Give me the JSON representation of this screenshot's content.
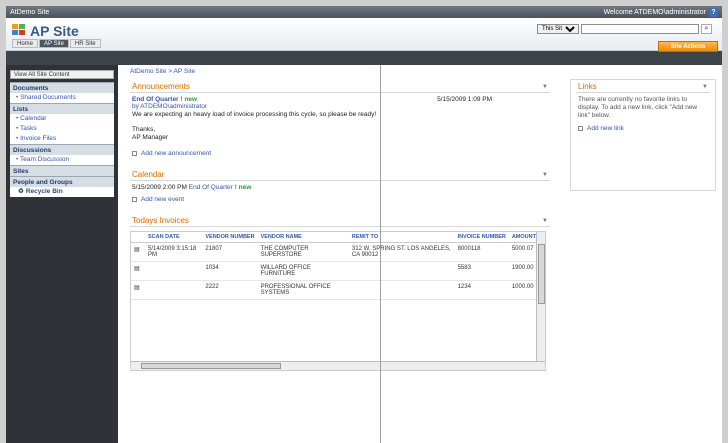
{
  "topbar": {
    "site": "AtDemo Site",
    "welcome": "Welcome ATDEMO\\administrator",
    "help": "?"
  },
  "header": {
    "title": "AP Site",
    "search_scope": "This Site",
    "search_go": "⌕"
  },
  "nav_tabs": [
    "Home",
    "AP Site",
    "HR Site"
  ],
  "site_actions": "Site Actions",
  "breadcrumb": "AtDemo Site > AP Site",
  "leftnav": {
    "view_all": "View All Site Content",
    "sections": [
      {
        "title": "Documents",
        "items": [
          "Shared Documents"
        ]
      },
      {
        "title": "Lists",
        "items": [
          "Calendar",
          "Tasks",
          "Invoice Files"
        ]
      },
      {
        "title": "Discussions",
        "items": [
          "Team Discussion"
        ]
      },
      {
        "title": "Sites",
        "items": []
      },
      {
        "title": "People and Groups",
        "items": []
      }
    ],
    "recycle_bin": "Recycle Bin"
  },
  "announcements": {
    "title": "Announcements",
    "item_title": "End Of Quarter",
    "item_new": "! new",
    "item_date": "5/15/2009 1:09 PM",
    "item_by": "by ATDEMO\\administrator",
    "item_body": "We are expecting an heavy load of invoice processing this cycle, so please be ready!",
    "item_sign1": "Thanks,",
    "item_sign2": "AP Manager",
    "add_new": "Add new announcement"
  },
  "calendar": {
    "title": "Calendar",
    "entry_date": "5/15/2009 2:00 PM",
    "entry_title": "End Of Quarter",
    "entry_new": "! new",
    "add_new": "Add new event"
  },
  "invoices": {
    "title": "Todays Invoices",
    "columns": [
      "SCAN DATE",
      "VENDOR NUMBER",
      "VENDOR NAME",
      "REMIT TO",
      "INVOICE NUMBER",
      "AMOUNT"
    ],
    "rows": [
      {
        "scan": "5/14/2009 3:15:18 PM",
        "vnum": "21807",
        "vname": "THE COMPUTER SUPERSTORE",
        "remit": "312 W. SPRING ST. LOS ANGELES, CA 90012",
        "inv": "8000118",
        "amt": "5000.07"
      },
      {
        "scan": "",
        "vnum": "1034",
        "vname": "WILLARD OFFICE FURNITURE",
        "remit": "",
        "inv": "5583",
        "amt": "1900.00"
      },
      {
        "scan": "",
        "vnum": "2222",
        "vname": "PROFESSIONAL OFFICE SYSTEMS",
        "remit": "",
        "inv": "1234",
        "amt": "1000.00"
      }
    ]
  },
  "links": {
    "title": "Links",
    "text": "There are currently no favorite links to display. To add a new link, click \"Add new link\" below.",
    "add_new": "Add new link"
  }
}
